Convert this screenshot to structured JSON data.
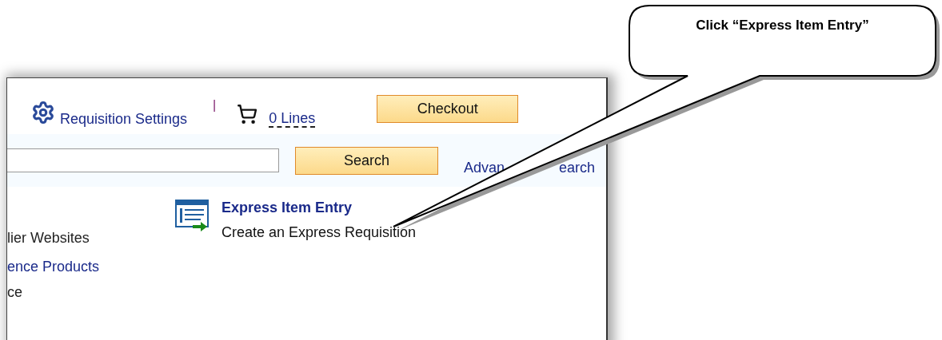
{
  "toolbar": {
    "settings_link": "Requisition Settings",
    "separator": "|",
    "cart_link": "0 Lines",
    "checkout_button": "Checkout"
  },
  "search": {
    "search_button": "Search",
    "advanced_search_visible": [
      "Advan",
      "earch"
    ]
  },
  "express_item": {
    "title": "Express Item Entry",
    "description": "Create an Express Requisition"
  },
  "left_links": [
    {
      "text": "lier Websites",
      "kind": "text"
    },
    {
      "text": "ence Products",
      "kind": "link"
    },
    {
      "text": "ce",
      "kind": "text"
    }
  ],
  "callout": {
    "text": "Click “Express Item Entry”"
  }
}
